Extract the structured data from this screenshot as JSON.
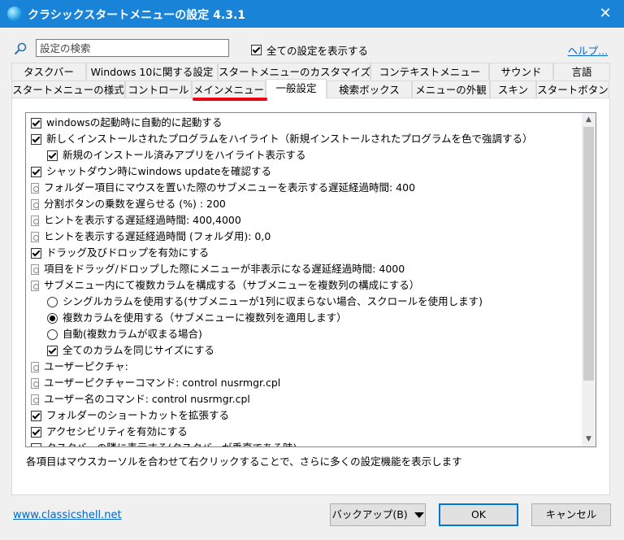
{
  "window": {
    "title": "クラシックスタートメニューの設定 4.3.1",
    "close_glyph": "✕"
  },
  "toolbar": {
    "search_placeholder": "設定の検索",
    "show_all_label": "全ての設定を表示する",
    "show_all_checked": true,
    "help_label": "ヘルプ..."
  },
  "tabs_row1": [
    "タスクバー",
    "Windows 10に関する設定",
    "スタートメニューのカスタマイズ",
    "コンテキストメニュー",
    "サウンド",
    "言語"
  ],
  "tabs_row2": [
    "スタートメニューの様式",
    "コントロール",
    "メインメニュー",
    "一般設定",
    "検索ボックス",
    "メニューの外観",
    "スキン",
    "スタートボタン"
  ],
  "active_tab": "一般設定",
  "highlight_color": "#e60012",
  "settings": [
    {
      "label": "windowsの起動時に自動的に起動する",
      "type": "checkbox",
      "checked": true,
      "indent": 0
    },
    {
      "label": "新しくインストールされたプログラムをハイライト（新規インストールされたプログラムを色で強調する）",
      "type": "checkbox",
      "checked": true,
      "indent": 0
    },
    {
      "label": "新規のインストール済みアプリをハイライト表示する",
      "type": "checkbox",
      "checked": true,
      "indent": 1
    },
    {
      "label": "シャットダウン時にwindows updateを確認する",
      "type": "checkbox",
      "checked": true,
      "indent": 0
    },
    {
      "label": "フォルダー項目にマウスを置いた際のサブメニューを表示する遅延経過時間: 400",
      "type": "doc",
      "indent": 0
    },
    {
      "label": "分割ボタンの乗数を遅らせる (%) : 200",
      "type": "doc",
      "indent": 0
    },
    {
      "label": "ヒントを表示する遅延経過時間: 400,4000",
      "type": "doc",
      "indent": 0
    },
    {
      "label": "ヒントを表示する遅延経過時間 (フォルダ用): 0,0",
      "type": "doc",
      "indent": 0
    },
    {
      "label": "ドラッグ及びドロップを有効にする",
      "type": "checkbox",
      "checked": true,
      "indent": 0
    },
    {
      "label": "項目をドラッグ/ドロップした際にメニューが非表示になる遅延経過時間: 4000",
      "type": "doc",
      "indent": 0
    },
    {
      "label": "サブメニュー内にて複数カラムを構成する（サブメニューを複数列の構成にする）",
      "type": "doc",
      "indent": 0
    },
    {
      "label": "シングルカラムを使用する(サブメニューが1列に収まらない場合、スクロールを使用します)",
      "type": "radio",
      "checked": false,
      "indent": 1
    },
    {
      "label": "複数カラムを使用する（サブメニューに複数列を適用します）",
      "type": "radio",
      "checked": true,
      "indent": 1
    },
    {
      "label": "自動(複数カラムが収まる場合)",
      "type": "radio",
      "checked": false,
      "indent": 1
    },
    {
      "label": "全てのカラムを同じサイズにする",
      "type": "checkbox",
      "checked": true,
      "indent": 1
    },
    {
      "label": "ユーザーピクチャ:",
      "type": "doc",
      "indent": 0
    },
    {
      "label": "ユーザーピクチャーコマンド: control nusrmgr.cpl",
      "type": "doc",
      "indent": 0
    },
    {
      "label": "ユーザー名のコマンド: control nusrmgr.cpl",
      "type": "doc",
      "indent": 0
    },
    {
      "label": "フォルダーのショートカットを拡張する",
      "type": "checkbox",
      "checked": true,
      "indent": 0
    },
    {
      "label": "アクセシビリティを有効にする",
      "type": "checkbox",
      "checked": true,
      "indent": 0
    },
    {
      "label": "タスクバーの隣に表示する(タスクバーが垂直である時)",
      "type": "checkbox",
      "checked": false,
      "indent": 0
    }
  ],
  "hint_text": "各項目はマウスカーソルを合わせて右クリックすることで、さらに多くの設定機能を表示します",
  "footer": {
    "website_link": "www.classicshell.net",
    "backup_label": "バックアップ(B)",
    "ok_label": "OK",
    "cancel_label": "キャンセル"
  }
}
